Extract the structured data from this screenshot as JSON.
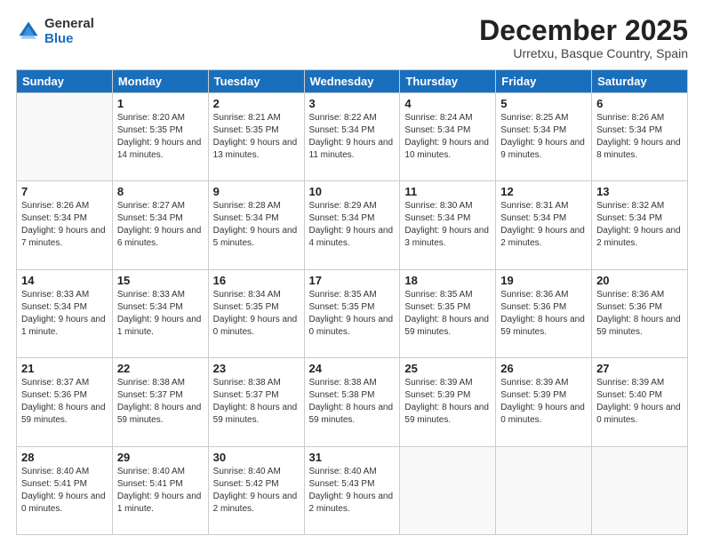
{
  "header": {
    "logo_general": "General",
    "logo_blue": "Blue",
    "month_title": "December 2025",
    "location": "Urretxu, Basque Country, Spain"
  },
  "columns": [
    "Sunday",
    "Monday",
    "Tuesday",
    "Wednesday",
    "Thursday",
    "Friday",
    "Saturday"
  ],
  "weeks": [
    [
      {
        "day": "",
        "sunrise": "",
        "sunset": "",
        "daylight": ""
      },
      {
        "day": "1",
        "sunrise": "8:20 AM",
        "sunset": "5:35 PM",
        "daylight": "9 hours and 14 minutes."
      },
      {
        "day": "2",
        "sunrise": "8:21 AM",
        "sunset": "5:35 PM",
        "daylight": "9 hours and 13 minutes."
      },
      {
        "day": "3",
        "sunrise": "8:22 AM",
        "sunset": "5:34 PM",
        "daylight": "9 hours and 11 minutes."
      },
      {
        "day": "4",
        "sunrise": "8:24 AM",
        "sunset": "5:34 PM",
        "daylight": "9 hours and 10 minutes."
      },
      {
        "day": "5",
        "sunrise": "8:25 AM",
        "sunset": "5:34 PM",
        "daylight": "9 hours and 9 minutes."
      },
      {
        "day": "6",
        "sunrise": "8:26 AM",
        "sunset": "5:34 PM",
        "daylight": "9 hours and 8 minutes."
      }
    ],
    [
      {
        "day": "7",
        "sunrise": "8:26 AM",
        "sunset": "5:34 PM",
        "daylight": "9 hours and 7 minutes."
      },
      {
        "day": "8",
        "sunrise": "8:27 AM",
        "sunset": "5:34 PM",
        "daylight": "9 hours and 6 minutes."
      },
      {
        "day": "9",
        "sunrise": "8:28 AM",
        "sunset": "5:34 PM",
        "daylight": "9 hours and 5 minutes."
      },
      {
        "day": "10",
        "sunrise": "8:29 AM",
        "sunset": "5:34 PM",
        "daylight": "9 hours and 4 minutes."
      },
      {
        "day": "11",
        "sunrise": "8:30 AM",
        "sunset": "5:34 PM",
        "daylight": "9 hours and 3 minutes."
      },
      {
        "day": "12",
        "sunrise": "8:31 AM",
        "sunset": "5:34 PM",
        "daylight": "9 hours and 2 minutes."
      },
      {
        "day": "13",
        "sunrise": "8:32 AM",
        "sunset": "5:34 PM",
        "daylight": "9 hours and 2 minutes."
      }
    ],
    [
      {
        "day": "14",
        "sunrise": "8:33 AM",
        "sunset": "5:34 PM",
        "daylight": "9 hours and 1 minute."
      },
      {
        "day": "15",
        "sunrise": "8:33 AM",
        "sunset": "5:34 PM",
        "daylight": "9 hours and 1 minute."
      },
      {
        "day": "16",
        "sunrise": "8:34 AM",
        "sunset": "5:35 PM",
        "daylight": "9 hours and 0 minutes."
      },
      {
        "day": "17",
        "sunrise": "8:35 AM",
        "sunset": "5:35 PM",
        "daylight": "9 hours and 0 minutes."
      },
      {
        "day": "18",
        "sunrise": "8:35 AM",
        "sunset": "5:35 PM",
        "daylight": "8 hours and 59 minutes."
      },
      {
        "day": "19",
        "sunrise": "8:36 AM",
        "sunset": "5:36 PM",
        "daylight": "8 hours and 59 minutes."
      },
      {
        "day": "20",
        "sunrise": "8:36 AM",
        "sunset": "5:36 PM",
        "daylight": "8 hours and 59 minutes."
      }
    ],
    [
      {
        "day": "21",
        "sunrise": "8:37 AM",
        "sunset": "5:36 PM",
        "daylight": "8 hours and 59 minutes."
      },
      {
        "day": "22",
        "sunrise": "8:38 AM",
        "sunset": "5:37 PM",
        "daylight": "8 hours and 59 minutes."
      },
      {
        "day": "23",
        "sunrise": "8:38 AM",
        "sunset": "5:37 PM",
        "daylight": "8 hours and 59 minutes."
      },
      {
        "day": "24",
        "sunrise": "8:38 AM",
        "sunset": "5:38 PM",
        "daylight": "8 hours and 59 minutes."
      },
      {
        "day": "25",
        "sunrise": "8:39 AM",
        "sunset": "5:39 PM",
        "daylight": "8 hours and 59 minutes."
      },
      {
        "day": "26",
        "sunrise": "8:39 AM",
        "sunset": "5:39 PM",
        "daylight": "9 hours and 0 minutes."
      },
      {
        "day": "27",
        "sunrise": "8:39 AM",
        "sunset": "5:40 PM",
        "daylight": "9 hours and 0 minutes."
      }
    ],
    [
      {
        "day": "28",
        "sunrise": "8:40 AM",
        "sunset": "5:41 PM",
        "daylight": "9 hours and 0 minutes."
      },
      {
        "day": "29",
        "sunrise": "8:40 AM",
        "sunset": "5:41 PM",
        "daylight": "9 hours and 1 minute."
      },
      {
        "day": "30",
        "sunrise": "8:40 AM",
        "sunset": "5:42 PM",
        "daylight": "9 hours and 2 minutes."
      },
      {
        "day": "31",
        "sunrise": "8:40 AM",
        "sunset": "5:43 PM",
        "daylight": "9 hours and 2 minutes."
      },
      {
        "day": "",
        "sunrise": "",
        "sunset": "",
        "daylight": ""
      },
      {
        "day": "",
        "sunrise": "",
        "sunset": "",
        "daylight": ""
      },
      {
        "day": "",
        "sunrise": "",
        "sunset": "",
        "daylight": ""
      }
    ]
  ]
}
